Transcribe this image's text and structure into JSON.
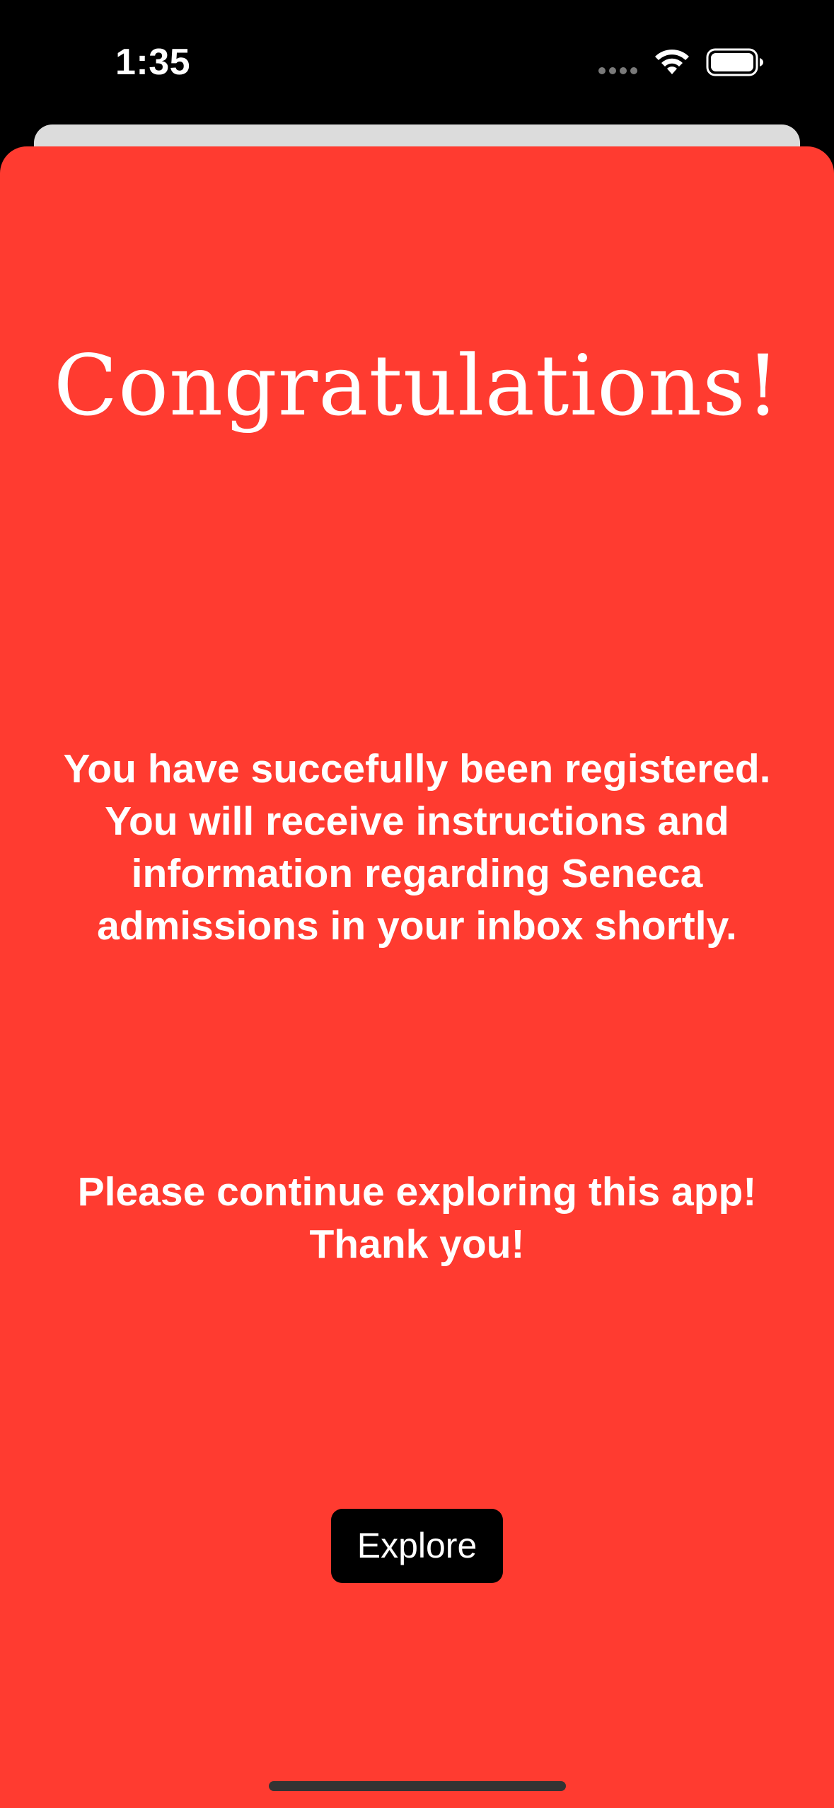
{
  "status_bar": {
    "time": "1:35",
    "icons": [
      "cellular-signal-icon",
      "wifi-icon",
      "battery-icon"
    ]
  },
  "registration_confirmation": {
    "title": "Congratulations!",
    "message": "You have succefully been registered. You will receive instructions and information regarding Seneca admissions in your inbox shortly.",
    "closing_text": "Please continue exploring this app! Thank you!",
    "explore_button_label": "Explore"
  },
  "colors": {
    "background": "#ff3b30",
    "button_background": "#000000",
    "text": "#ffffff"
  }
}
